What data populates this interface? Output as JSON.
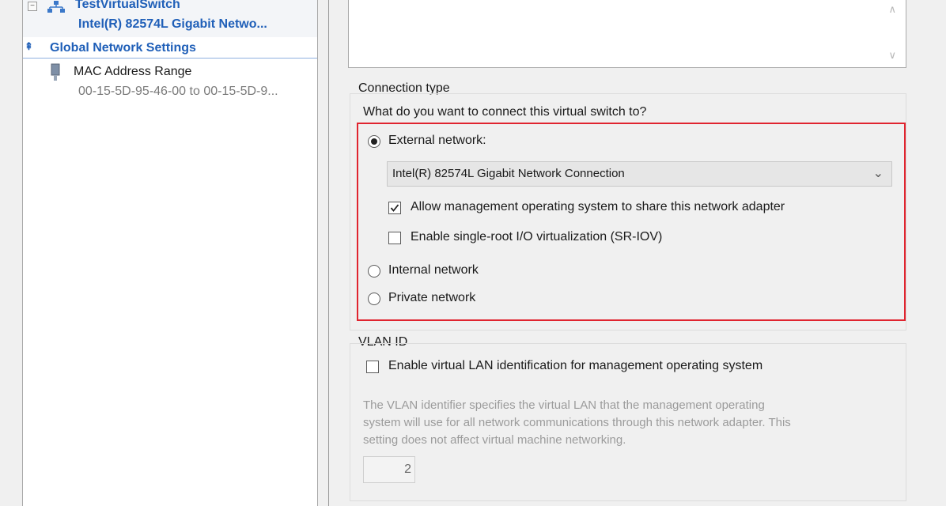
{
  "tree": {
    "switch_name": "TestVirtualSwitch",
    "switch_adapter": "Intel(R) 82574L Gigabit Netwo...",
    "global_section_label": "Global Network Settings",
    "mac_range_label": "MAC Address Range",
    "mac_range_value": "00-15-5D-95-46-00 to 00-15-5D-9..."
  },
  "connection": {
    "group_label": "Connection type",
    "question": "What do you want to connect this virtual switch to?",
    "external_label": "External network:",
    "selected_option": "External network",
    "adapter_value": "Intel(R) 82574L Gigabit Network Connection",
    "allow_management_label": "Allow management operating system to share this network adapter",
    "allow_management_checked": true,
    "sriov_label": "Enable single-root I/O virtualization (SR-IOV)",
    "sriov_checked": false,
    "internal_label": "Internal network",
    "private_label": "Private network"
  },
  "vlan": {
    "group_label": "VLAN ID",
    "enable_label": "Enable virtual LAN identification for management operating system",
    "enable_checked": false,
    "description_line1": "The VLAN identifier specifies the virtual LAN that the management operating",
    "description_line2": "system will use for all network communications through this network adapter. This",
    "description_line3": "setting does not affect virtual machine networking.",
    "vlan_id_value": "2"
  },
  "colors": {
    "highlight": "#e0242f",
    "tree_link": "#1f5fb8"
  }
}
